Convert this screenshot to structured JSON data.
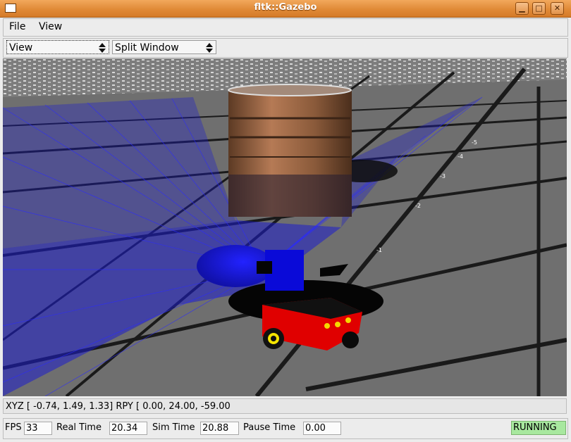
{
  "window": {
    "title": "fltk::Gazebo",
    "minimize_label": "▁",
    "maximize_label": "□",
    "close_label": "✕"
  },
  "menubar": {
    "file": "File",
    "view": "View"
  },
  "toolbar": {
    "view_choice": "View",
    "window_choice": "Split Window"
  },
  "viewport": {
    "axis_labels": [
      "-1",
      "-2",
      "-3",
      "-4",
      "-5"
    ],
    "colors": {
      "laser": "#1a1aff",
      "floor": "#6e6e6e",
      "grid": "#1a1a1a",
      "robot_body": "#e00000",
      "barrel": "#8a5a3a"
    }
  },
  "status": {
    "pose_text": "XYZ [ -0.74,   1.49,   1.33] RPY [  0.00,  24.00, -59.00"
  },
  "bottombar": {
    "fps_label": "FPS",
    "fps_value": "33",
    "real_time_label": "Real Time",
    "real_time_value": "20.34",
    "sim_time_label": "Sim Time",
    "sim_time_value": "20.88",
    "pause_time_label": "Pause Time",
    "pause_time_value": "0.00",
    "state": "RUNNING"
  }
}
